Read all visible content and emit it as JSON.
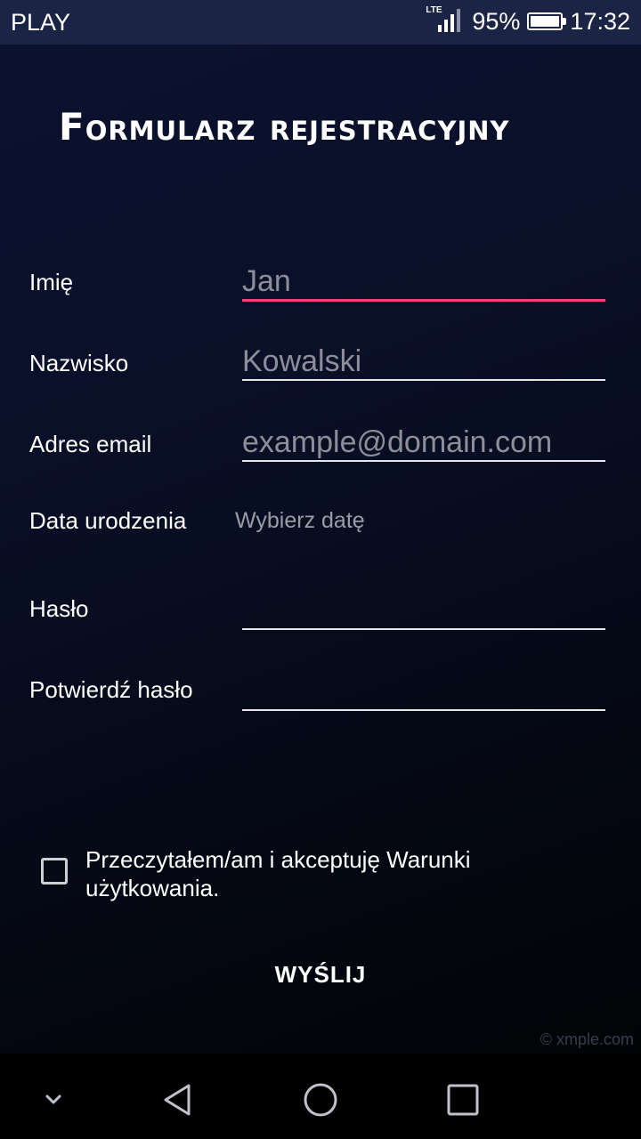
{
  "status_bar": {
    "carrier": "PLAY",
    "network": "LTE",
    "battery_percent": "95%",
    "battery_level": 0.95,
    "time": "17:32"
  },
  "page": {
    "title": "Formularz rejestracyjny"
  },
  "form": {
    "first_name": {
      "label": "Imię",
      "placeholder": "Jan"
    },
    "last_name": {
      "label": "Nazwisko",
      "placeholder": "Kowalski"
    },
    "email": {
      "label": "Adres email",
      "placeholder": "example@domain.com"
    },
    "birth_date": {
      "label": "Data urodzenia",
      "value": "Wybierz datę"
    },
    "password": {
      "label": "Hasło",
      "value": ""
    },
    "confirm_password": {
      "label": "Potwierdź hasło",
      "value": ""
    },
    "terms": {
      "label": "Przeczytałem/am i akceptuję Warunki użytkowania.",
      "checked": false
    },
    "submit_label": "WYŚLIJ"
  },
  "watermark": "© xmple.com",
  "navigation": {
    "icons": [
      "chevron-down-icon",
      "back-icon",
      "home-icon",
      "recents-icon"
    ]
  },
  "colors": {
    "accent": "#e8457a",
    "status_bar": "#1b2445"
  }
}
